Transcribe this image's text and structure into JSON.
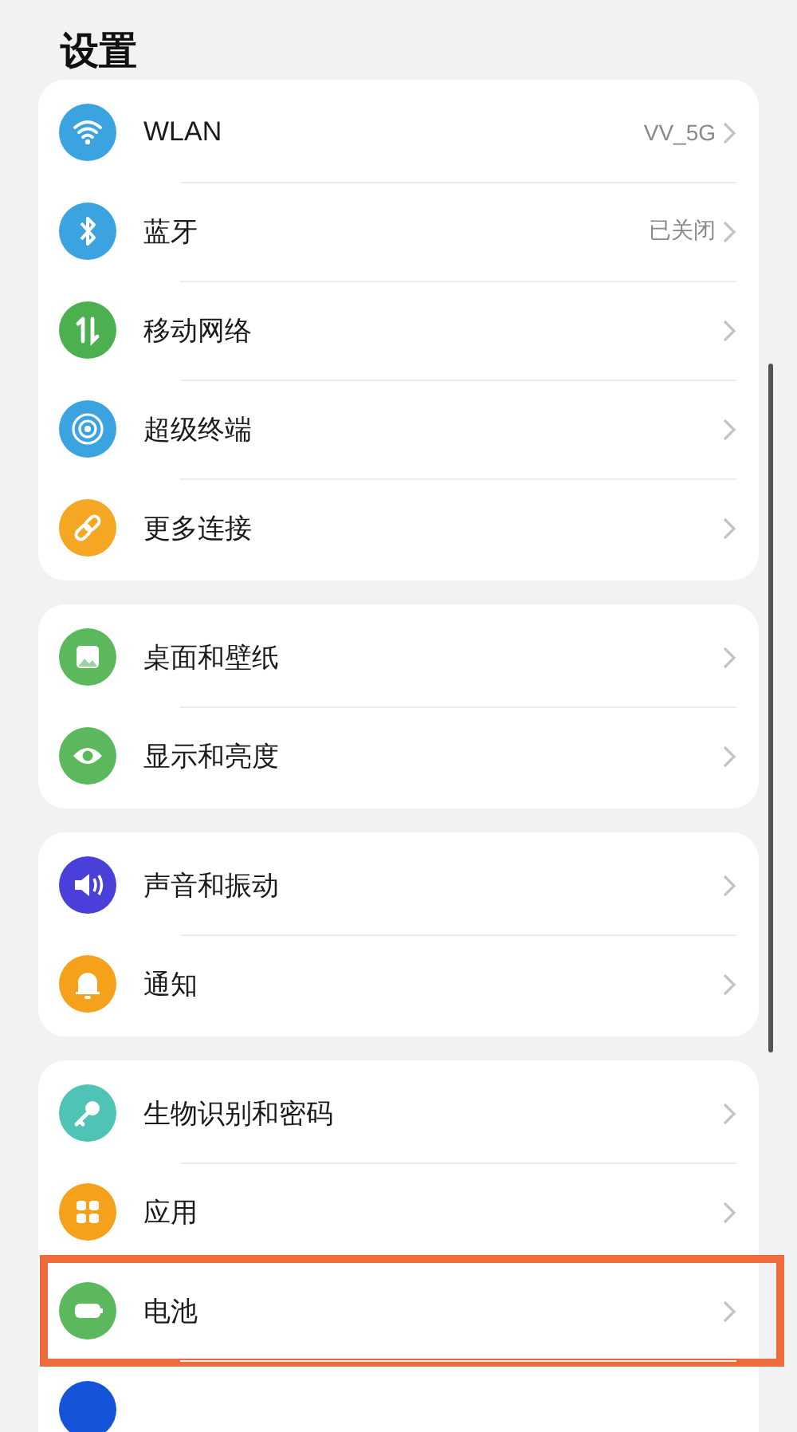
{
  "title": "设置",
  "groups": [
    {
      "items": [
        {
          "kind": "wifi",
          "color": "#3ba4e0",
          "label": "WLAN",
          "value": "VV_5G",
          "highlighted": false
        },
        {
          "kind": "bluetooth",
          "color": "#3ba4e0",
          "label": "蓝牙",
          "value": "已关闭",
          "highlighted": false
        },
        {
          "kind": "mobile-data",
          "color": "#4caf50",
          "label": "移动网络",
          "highlighted": false
        },
        {
          "kind": "super-device",
          "color": "#3ba4e0",
          "label": "超级终端",
          "highlighted": false
        },
        {
          "kind": "link",
          "color": "#f5a623",
          "label": "更多连接",
          "highlighted": false
        }
      ]
    },
    {
      "items": [
        {
          "kind": "wallpaper",
          "color": "#5cb85c",
          "label": "桌面和壁纸",
          "highlighted": false
        },
        {
          "kind": "eye",
          "color": "#5cb85c",
          "label": "显示和亮度",
          "highlighted": false
        }
      ]
    },
    {
      "items": [
        {
          "kind": "speaker",
          "color": "#4a3fd8",
          "label": "声音和振动",
          "highlighted": false
        },
        {
          "kind": "bell",
          "color": "#f5a11c",
          "label": "通知",
          "highlighted": false
        }
      ]
    },
    {
      "items": [
        {
          "kind": "key",
          "color": "#4fc3b5",
          "label": "生物识别和密码",
          "highlighted": false
        },
        {
          "kind": "apps",
          "color": "#f5a11c",
          "label": "应用",
          "highlighted": false
        },
        {
          "kind": "battery",
          "color": "#5cb85c",
          "label": "电池",
          "highlighted": true
        },
        {
          "kind": "blank",
          "color": "#1553d9",
          "highlighted": false
        }
      ]
    }
  ]
}
